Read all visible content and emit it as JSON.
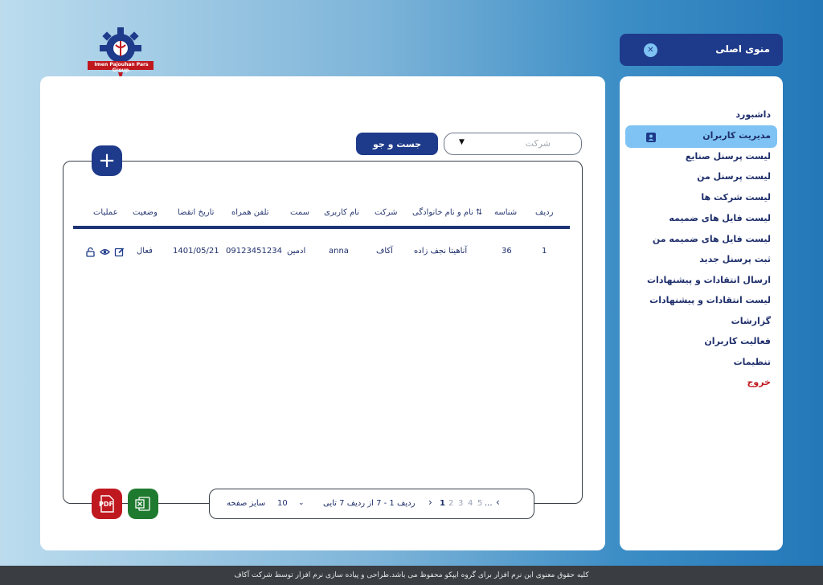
{
  "logo": {
    "text": "Imen Pajouhan Pars Group."
  },
  "filter": {
    "placeholder": "شرکت"
  },
  "search": {
    "label": "جست و جو"
  },
  "add": {
    "label": "+"
  },
  "table": {
    "headers": [
      "ردیف",
      "شناسه",
      "نام و نام خانوادگی",
      "شرکت",
      "نام کاربری",
      "سمت",
      "تلفن همراه",
      "تاریخ انقضا",
      "وضعیت",
      "عملیات"
    ],
    "rows": [
      {
        "row": "1",
        "id": "36",
        "name": "آناهیتا نجف زاده",
        "company": "آکاف",
        "username": "anna",
        "role": "ادمین",
        "phone": "09123451234",
        "expiry": "1401/05/21",
        "status": "فعال"
      }
    ]
  },
  "pager": {
    "prev": "‹",
    "next": "›",
    "ellipsis": "...",
    "pages": [
      "1",
      "2",
      "3",
      "4",
      "5"
    ],
    "current_page": "1",
    "range_text": "ردیف 1 - 7 از ردیف 7 تایی",
    "page_size": "10",
    "page_size_label": "سایز صفحه"
  },
  "export": {
    "pdf": "PDF"
  },
  "menu": {
    "title": "منوی اصلی",
    "items": [
      {
        "label": "داشبورد"
      },
      {
        "label": "مدیریت کاربران",
        "active": true
      },
      {
        "label": "لیست پرسنل صنایع"
      },
      {
        "label": "لیست پرسنل من"
      },
      {
        "label": "لیست شرکت ها"
      },
      {
        "label": "لیست فایل های ضمیمه"
      },
      {
        "label": "لیست فایل های ضمیمه من"
      },
      {
        "label": "ثبت پرسنل جدید"
      },
      {
        "label": "ارسال انتقادات و پیشنهادات"
      },
      {
        "label": "لیست انتقادات و پیشنهادات"
      },
      {
        "label": "گزارشات"
      },
      {
        "label": "فعالیت کاربران"
      },
      {
        "label": "تنظیمات"
      },
      {
        "label": "خروج",
        "color": "#c0181f"
      }
    ]
  },
  "footer": {
    "text": "کلیه حقوق معنوی این نرم افزار برای گروه ایپکو محفوظ می باشد.طراحی و پیاده سازی نرم افزار توسط شرکت آکاف"
  },
  "colors": {
    "primary": "#1e3a8a",
    "accent": "#7ec3f3",
    "danger": "#c0181f",
    "excel": "#1e7a2e"
  }
}
